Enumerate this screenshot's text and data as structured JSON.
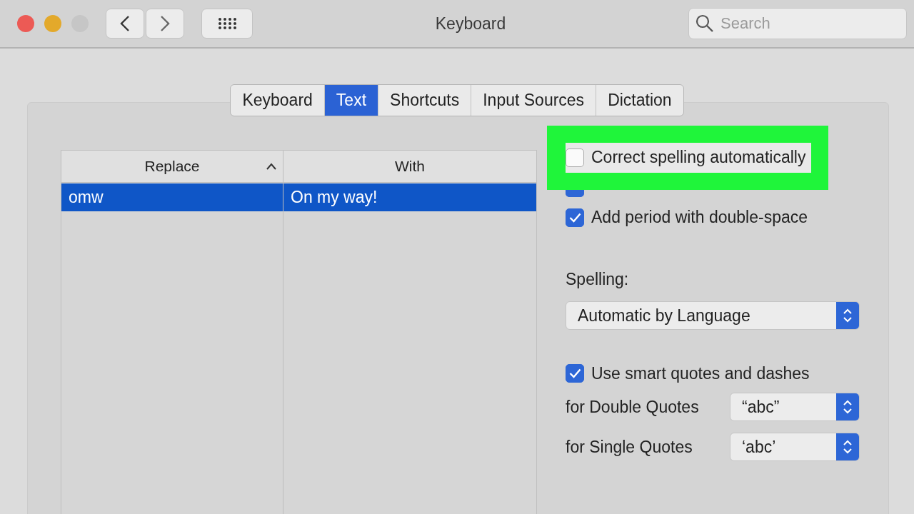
{
  "window": {
    "title": "Keyboard",
    "search": {
      "placeholder": "Search"
    }
  },
  "tabs": [
    {
      "label": "Keyboard",
      "selected": false
    },
    {
      "label": "Text",
      "selected": true
    },
    {
      "label": "Shortcuts",
      "selected": false
    },
    {
      "label": "Input Sources",
      "selected": false
    },
    {
      "label": "Dictation",
      "selected": false
    }
  ],
  "table": {
    "columns": [
      {
        "label": "Replace",
        "sorted": true
      },
      {
        "label": "With",
        "sorted": false
      }
    ],
    "rows": [
      {
        "cells": [
          "omw",
          "On my way!"
        ],
        "selected": true
      }
    ]
  },
  "options": [
    {
      "label": "Correct spelling automatically",
      "checked": false,
      "highlighted": true
    },
    {
      "checked": true,
      "highlighted": false
    },
    {
      "label": "Add period with double-space",
      "checked": true,
      "highlighted": false
    }
  ],
  "spelling": {
    "label": "Spelling:",
    "value": "Automatic by Language"
  },
  "smart_quotes": {
    "label": "Use smart quotes and dashes",
    "checked": true
  },
  "quotes": [
    {
      "label": "for Double Quotes",
      "value": "“abc”"
    },
    {
      "label": "for Single Quotes",
      "value": "‘abc’"
    }
  ]
}
